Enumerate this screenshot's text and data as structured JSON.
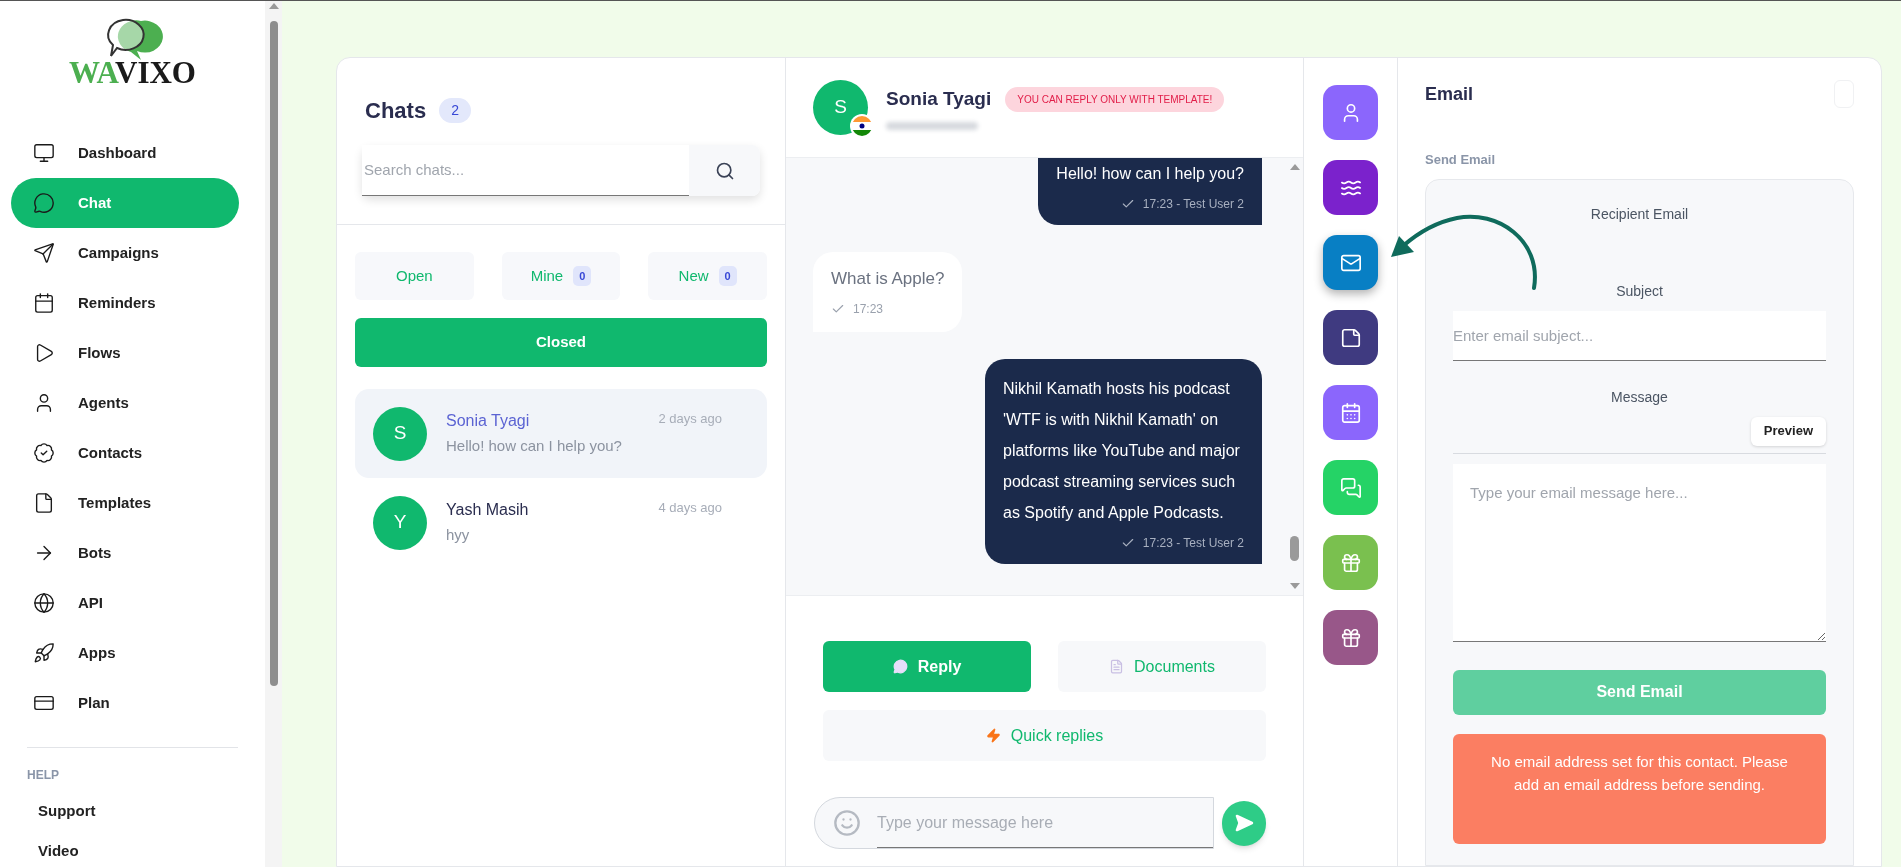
{
  "logo": {
    "accent_text": "WA",
    "text": "VIXO"
  },
  "sidebar": {
    "items": [
      {
        "label": "Dashboard",
        "selected": false
      },
      {
        "label": "Chat",
        "selected": true
      },
      {
        "label": "Campaigns",
        "selected": false
      },
      {
        "label": "Reminders",
        "selected": false
      },
      {
        "label": "Flows",
        "selected": false
      },
      {
        "label": "Agents",
        "selected": false
      },
      {
        "label": "Contacts",
        "selected": false
      },
      {
        "label": "Templates",
        "selected": false
      },
      {
        "label": "Bots",
        "selected": false
      },
      {
        "label": "API",
        "selected": false
      },
      {
        "label": "Apps",
        "selected": false
      },
      {
        "label": "Plan",
        "selected": false
      }
    ],
    "section_title": "HELP",
    "help_items": [
      {
        "label": "Support"
      },
      {
        "label": "Video"
      }
    ]
  },
  "chats": {
    "title": "Chats",
    "count": "2",
    "search": {
      "placeholder": "Search chats..."
    },
    "filters": [
      {
        "label": "Open",
        "selected": false
      },
      {
        "label": "Mine",
        "count": "0",
        "selected": false
      },
      {
        "label": "New",
        "count": "0",
        "selected": false
      },
      {
        "label": "Closed",
        "selected": true
      }
    ],
    "items": [
      {
        "initial": "S",
        "name": "Sonia Tyagi",
        "time": "2 days ago",
        "preview": "Hello! how can I help you?",
        "selected": true
      },
      {
        "initial": "Y",
        "name": "Yash Masih",
        "time": "4 days ago",
        "preview": "hyy",
        "selected": false
      }
    ]
  },
  "conversation": {
    "contact": {
      "initial": "S",
      "name": "Sonia Tyagi"
    },
    "notice": "YOU CAN REPLY ONLY WITH TEMPLATE!",
    "messages": [
      {
        "kind": "outgoing",
        "text": "Hello! how can I help you?",
        "meta": "17:23 - Test User 2"
      },
      {
        "kind": "incoming",
        "text": "What is Apple?",
        "meta": "17:23"
      },
      {
        "kind": "outgoing",
        "text": "Nikhil Kamath hosts his podcast 'WTF is with Nikhil Kamath' on platforms like YouTube and major podcast streaming services such as Spotify and Apple Podcasts.",
        "meta": "17:23 - Test User 2"
      }
    ],
    "actions": [
      {
        "label": "Reply",
        "selected": true
      },
      {
        "label": "Documents",
        "selected": false
      },
      {
        "label": "Quick replies",
        "selected": false
      }
    ],
    "composer": {
      "placeholder": "Type your message here"
    }
  },
  "tools": [
    {
      "color": "#8b66fc",
      "selected": false
    },
    {
      "color": "#7b22cc",
      "selected": false
    },
    {
      "color": "#087fc4",
      "selected": true
    },
    {
      "color": "#3f3a80",
      "selected": false
    },
    {
      "color": "#8b66fc",
      "selected": false
    },
    {
      "color": "#25d366",
      "selected": false
    },
    {
      "color": "#7ac04f",
      "selected": false
    },
    {
      "color": "#985789",
      "selected": false
    }
  ],
  "email": {
    "title": "Email",
    "section": "Send Email",
    "recipient_label": "Recipient Email",
    "subject_label": "Subject",
    "subject": {
      "placeholder": "Enter email subject..."
    },
    "message_label": "Message",
    "preview_button": "Preview",
    "message": {
      "placeholder": "Type your email message here..."
    },
    "send_button": "Send Email",
    "error": "No email address set for this contact. Please add an email address before sending."
  }
}
